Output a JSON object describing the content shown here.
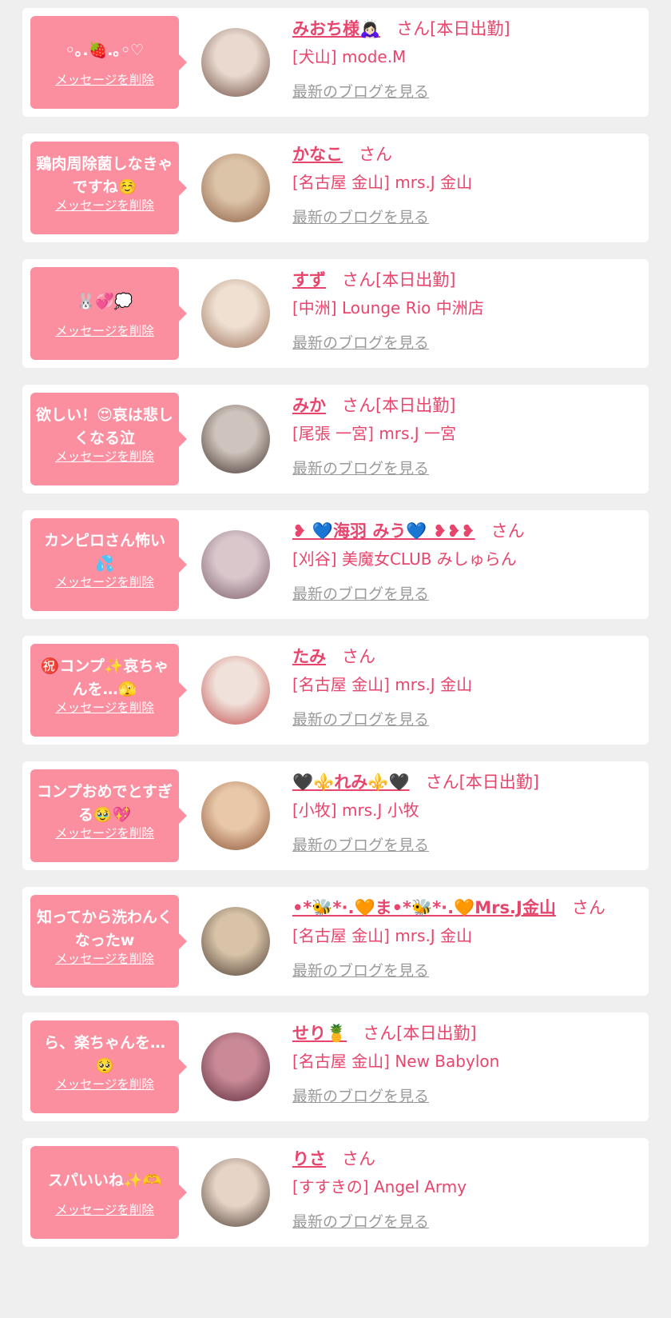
{
  "common": {
    "delete_label": "メッセージを削除",
    "san_label": "さん",
    "blog_label": "最新のブログを見る"
  },
  "items": [
    {
      "message": "◦｡.🍓.｡◦♡",
      "name": "みおち様🙇🏻‍♀️",
      "duty": "[本日出勤]",
      "area": "[犬山]",
      "shop": "mode.M",
      "avatar_colors": [
        "#e9d9cf",
        "#6b4a3d"
      ]
    },
    {
      "message": "鶏肉周除菌しなきゃですね☺️",
      "name": "かなこ",
      "duty": "",
      "area": "[名古屋 金山]",
      "shop": "mrs.J 金山",
      "avatar_colors": [
        "#dcc4a8",
        "#8a5a40"
      ]
    },
    {
      "message": "🐰💞💭",
      "name": "すず",
      "duty": "[本日出勤]",
      "area": "[中洲]",
      "shop": "Lounge Rio 中洲店",
      "avatar_colors": [
        "#efe0d2",
        "#9b7058"
      ]
    },
    {
      "message": "欲しい！😍哀は悲しくなる泣",
      "name": "みか",
      "duty": "[本日出勤]",
      "area": "[尾張 一宮]",
      "shop": "mrs.J 一宮",
      "avatar_colors": [
        "#cfc4bd",
        "#3e2f2a"
      ]
    },
    {
      "message": "カンピロさん怖い💦",
      "name": "❥ 💙海羽 みう💙 ❥❥❥",
      "duty": "",
      "area": "[刈谷]",
      "shop": "美魔女CLUB みしゅらん",
      "avatar_colors": [
        "#d9c7cc",
        "#7b5a68"
      ]
    },
    {
      "message": "㊗️コンプ✨哀ちゃんを…🫣",
      "name": "たみ",
      "duty": "",
      "area": "[名古屋 金山]",
      "shop": "mrs.J 金山",
      "avatar_colors": [
        "#f0e2da",
        "#c24a4a"
      ]
    },
    {
      "message": "コンプおめでとすぎる🥹💖",
      "name": "🖤⚜️れみ⚜️🖤",
      "duty": "[本日出勤]",
      "area": "[小牧]",
      "shop": "mrs.J 小牧",
      "avatar_colors": [
        "#e8c8a8",
        "#8a5033"
      ]
    },
    {
      "message": "知ってから洗わんくなったw",
      "name": "•*🐝*·.🧡ま•*🐝*·.🧡Mrs.J金山",
      "duty": "",
      "area": "[名古屋 金山]",
      "shop": "mrs.J 金山",
      "avatar_colors": [
        "#d8c3a8",
        "#4a3a30"
      ]
    },
    {
      "message": "ら、楽ちゃんを…🥺",
      "name": "せり🍍",
      "duty": "[本日出勤]",
      "area": "[名古屋 金山]",
      "shop": "New Babylon",
      "avatar_colors": [
        "#c98a96",
        "#5a2a3a"
      ]
    },
    {
      "message": "スパいいね✨🫶",
      "name": "りさ",
      "duty": "",
      "area": "[すすきの]",
      "shop": "Angel Army",
      "avatar_colors": [
        "#e6d4c6",
        "#4c3b32"
      ]
    }
  ]
}
